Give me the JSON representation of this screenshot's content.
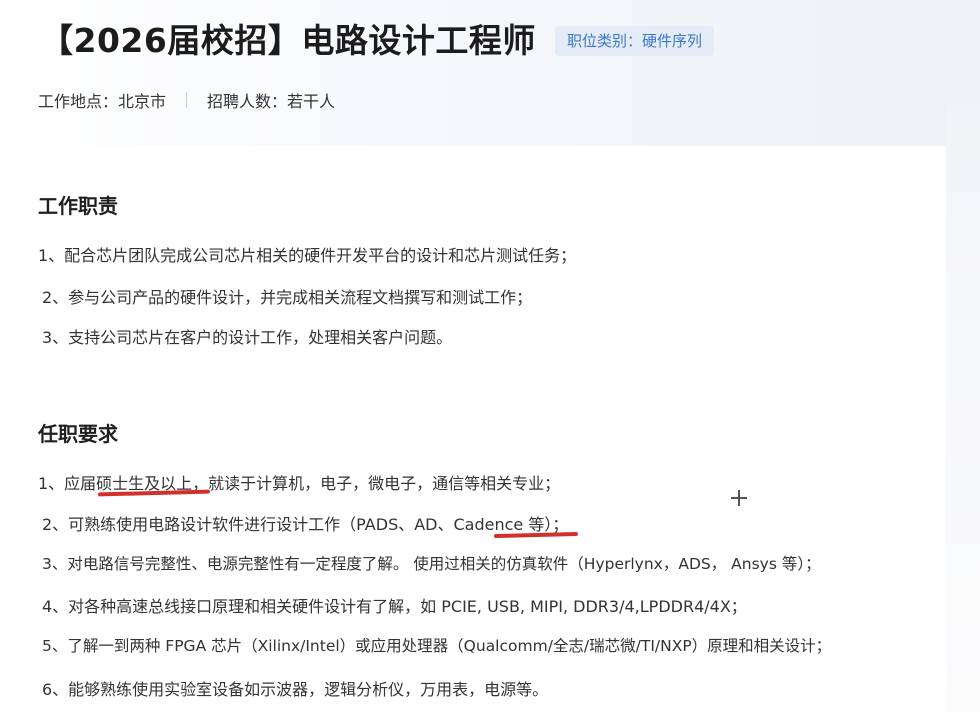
{
  "job": {
    "title": "【2026届校招】电路设计工程师",
    "category_badge": "职位类别：硬件序列",
    "location": "工作地点：北京市",
    "headcount": "招聘人数：若干人"
  },
  "responsibilities": {
    "heading": "工作职责",
    "items": [
      "1、配合芯片团队完成公司芯片相关的硬件开发平台的设计和芯片测试任务；",
      "2、参与公司产品的硬件设计，并完成相关流程文档撰写和测试工作；",
      "3、支持公司芯片在客户的设计工作，处理相关客户问题。"
    ]
  },
  "requirements": {
    "heading": "任职要求",
    "items": [
      "1、应届硕士生及以上，就读于计算机，电子，微电子，通信等相关专业；",
      "2、可熟练使用电路设计软件进行设计工作（PADS、AD、Cadence 等）；",
      "3、对电路信号完整性、电源完整性有一定程度了解。 使用过相关的仿真软件（Hyperlynx，ADS， Ansys 等）；",
      "4、对各种高速总线接口原理和相关硬件设计有了解，如 PCIE, USB, MIPI, DDR3/4,LPDDR4/4X；",
      "5、了解一到两种 FPGA 芯片（Xilinx/Intel）或应用处理器（Qualcomm/全志/瑞芯微/TI/NXP）原理和相关设计；",
      "6、能够熟练使用实验室设备如示波器，逻辑分析仪，万用表，电源等。"
    ]
  },
  "colors": {
    "badge_bg": "#e3ecf7",
    "badge_text": "#3c78c8",
    "annotation_red": "#d4302b"
  },
  "icons": {
    "cursor": "crosshair-cursor-icon"
  }
}
